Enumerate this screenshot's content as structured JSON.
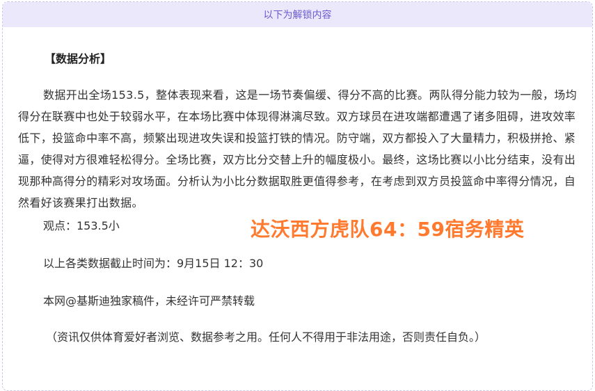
{
  "unlock_header": "以下为解锁内容",
  "section_title": "【数据分析】",
  "analysis_paragraph": "数据开出全场153.5，整体表现来看，这是一场节奏偏缓、得分不高的比赛。两队得分能力较为一般，场均得分在联赛中也处于较弱水平，在本场比赛中体现得淋漓尽致。双方球员在进攻端都遭遇了诸多阻碍，进攻效率低下，投篮命中率不高，频繁出现进攻失误和投篮打铁的情况。防守端，双方都投入了大量精力，积极拼抢、紧逼，使得对方很难轻松得分。全场比赛，双方比分交替上升的幅度极小。最终，这场比赛以小比分结束，没有出现那种高得分的精彩对攻场面。分析认为小比分数据取胜更值得参考，在考虑到双方员投篮命中率得分情况，自然看好该赛果打出数据。",
  "viewpoint": "观点：153.5小",
  "score_banner": "达沃西方虎队64：59宿务精英",
  "cutoff_time": "以上各类数据截止时间为：9月15日 12：30",
  "copyright": "本网@基斯迪独家稿件，未经许可严禁转载",
  "disclaimer": "（资讯仅供体育爱好者浏览、数据参考之用。任何人不得用于非法用途，否则责任自负。）",
  "colors": {
    "header_bg": "#ece8fb",
    "header_text": "#6a5ad0",
    "banner_text": "#ff7a2f",
    "body_text": "#333333"
  }
}
